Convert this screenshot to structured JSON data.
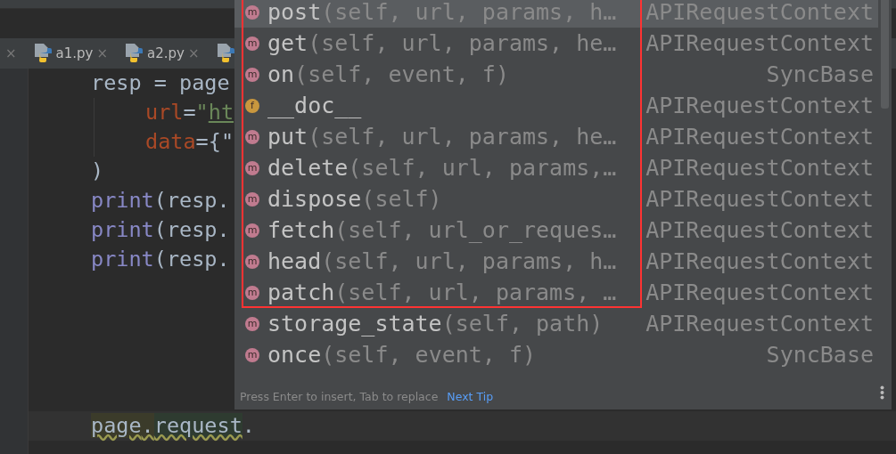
{
  "tabs": [
    {
      "kind": "edge",
      "close": "×"
    },
    {
      "kind": "file",
      "label": "a1.py",
      "close": "×"
    },
    {
      "kind": "file",
      "label": "a2.py",
      "close": "×"
    },
    {
      "kind": "file"
    }
  ],
  "code_lines": [
    {
      "indented": false,
      "tokens": [
        {
          "text": "resp = page",
          "kind": "plain"
        }
      ]
    },
    {
      "indented": true,
      "tokens": [
        {
          "text": "url",
          "kind": "param"
        },
        {
          "text": "=",
          "kind": "plain"
        },
        {
          "text": "\"",
          "kind": "string"
        },
        {
          "text": "ht",
          "kind": "link"
        }
      ]
    },
    {
      "indented": true,
      "tokens": [
        {
          "text": "data",
          "kind": "param"
        },
        {
          "text": "={\"",
          "kind": "plain"
        }
      ]
    },
    {
      "indented": false,
      "tokens": [
        {
          "text": ")",
          "kind": "plain"
        }
      ]
    },
    {
      "indented": false,
      "tokens": [
        {
          "text": "print",
          "kind": "builtin"
        },
        {
          "text": "(resp.",
          "kind": "plain"
        }
      ]
    },
    {
      "indented": false,
      "tokens": [
        {
          "text": "print",
          "kind": "builtin"
        },
        {
          "text": "(resp.",
          "kind": "plain"
        }
      ]
    },
    {
      "indented": false,
      "tokens": [
        {
          "text": "print",
          "kind": "builtin"
        },
        {
          "text": "(resp.",
          "kind": "plain"
        }
      ]
    }
  ],
  "current_line": [
    {
      "text": "page",
      "kind": "warn"
    },
    {
      "text": ".",
      "kind": "warn"
    },
    {
      "text": "request",
      "kind": "ref"
    },
    {
      "text": ".",
      "kind": "plain"
    }
  ],
  "completion": {
    "items": [
      {
        "kind": "method",
        "badge": "m",
        "name": "post",
        "signature": "(self, url, params, h…",
        "type": "APIRequestContext",
        "selected": true,
        "highlighted": true
      },
      {
        "kind": "method",
        "badge": "m",
        "name": "get",
        "signature": "(self, url, params, he…",
        "type": "APIRequestContext",
        "selected": false,
        "highlighted": true
      },
      {
        "kind": "method",
        "badge": "m",
        "name": "on",
        "signature": "(self, event, f)",
        "type": "SyncBase",
        "selected": false,
        "highlighted": true
      },
      {
        "kind": "field",
        "badge": "f",
        "name": "__doc__",
        "type": "APIRequestContext",
        "selected": false,
        "highlighted": true
      },
      {
        "kind": "method",
        "badge": "m",
        "name": "put",
        "signature": "(self, url, params, he…",
        "type": "APIRequestContext",
        "selected": false,
        "highlighted": true
      },
      {
        "kind": "method",
        "badge": "m",
        "name": "delete",
        "signature": "(self, url, params,…",
        "type": "APIRequestContext",
        "selected": false,
        "highlighted": true
      },
      {
        "kind": "method",
        "badge": "m",
        "name": "dispose",
        "signature": "(self)",
        "type": "APIRequestContext",
        "selected": false,
        "highlighted": true
      },
      {
        "kind": "method",
        "badge": "m",
        "name": "fetch",
        "signature": "(self, url_or_reques…",
        "type": "APIRequestContext",
        "selected": false,
        "highlighted": true
      },
      {
        "kind": "method",
        "badge": "m",
        "name": "head",
        "signature": "(self, url, params, h…",
        "type": "APIRequestContext",
        "selected": false,
        "highlighted": true
      },
      {
        "kind": "method",
        "badge": "m",
        "name": "patch",
        "signature": "(self, url, params, …",
        "type": "APIRequestContext",
        "selected": false,
        "highlighted": true
      },
      {
        "kind": "method",
        "badge": "m",
        "name": "storage_state",
        "signature": "(self, path)",
        "type": "APIRequestContext",
        "selected": false,
        "highlighted": false
      },
      {
        "kind": "method",
        "badge": "m",
        "name": "once",
        "signature": "(self, event, f)",
        "type": "SyncBase",
        "selected": false,
        "highlighted": false
      }
    ],
    "hint": "Press Enter to insert, Tab to replace",
    "tip_link": "Next Tip"
  }
}
